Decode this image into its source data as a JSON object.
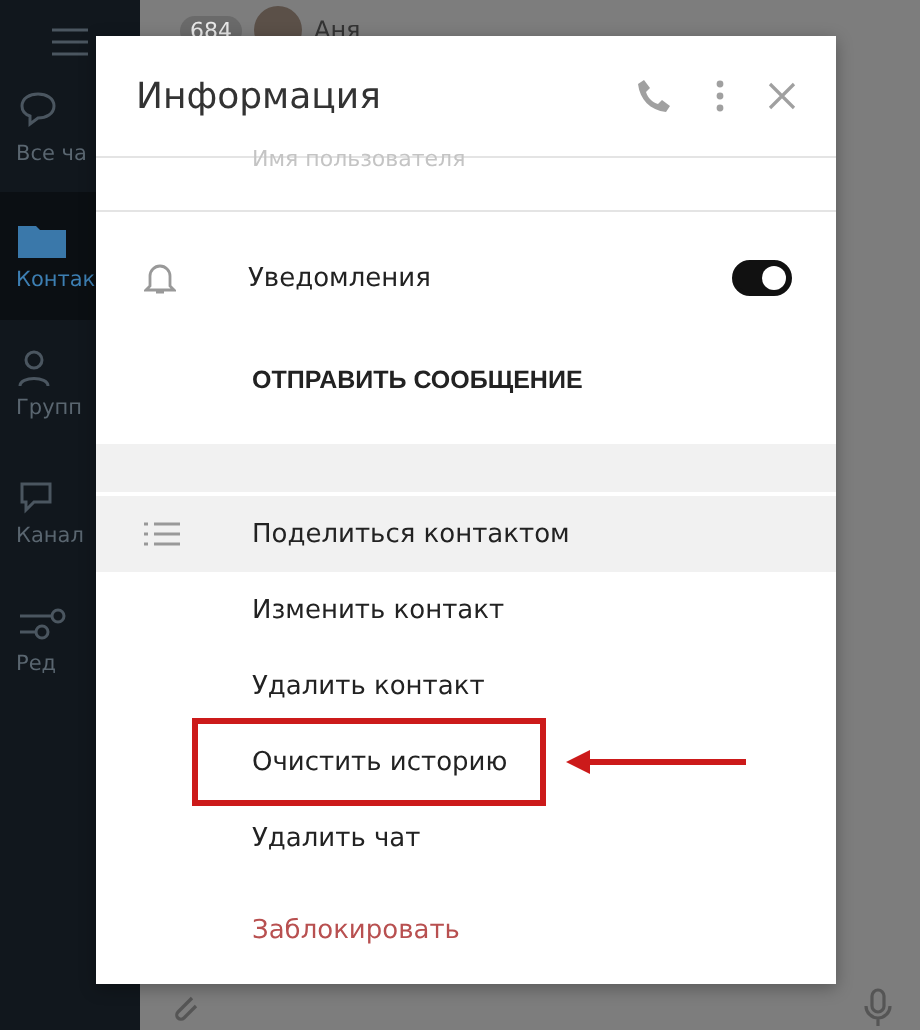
{
  "sidebar": {
    "items": [
      {
        "kind": "chats",
        "label": "Все ча",
        "selected": false
      },
      {
        "kind": "contacts",
        "label": "Контак",
        "selected": true
      },
      {
        "kind": "groups",
        "label": "Групп",
        "selected": false
      },
      {
        "kind": "channels",
        "label": "Канал",
        "selected": false
      },
      {
        "kind": "edit",
        "label": "Ред",
        "selected": false
      }
    ]
  },
  "chat_header": {
    "badge": "684",
    "name": "Аня"
  },
  "dialog": {
    "title": "Информация",
    "username_label": "Имя пользователя",
    "notifications": {
      "label": "Уведомления",
      "on": true
    },
    "send_message": "ОТПРАВИТЬ СООБЩЕНИЕ",
    "actions": [
      {
        "label": "Поделиться контактом",
        "kind": "normal",
        "selected": true,
        "annotated": false
      },
      {
        "label": "Изменить контакт",
        "kind": "normal",
        "selected": false,
        "annotated": false
      },
      {
        "label": "Удалить контакт",
        "kind": "normal",
        "selected": false,
        "annotated": false
      },
      {
        "label": "Очистить историю",
        "kind": "normal",
        "selected": false,
        "annotated": true
      },
      {
        "label": "Удалить чат",
        "kind": "normal",
        "selected": false,
        "annotated": false
      },
      {
        "label": "Заблокировать",
        "kind": "danger",
        "selected": false,
        "annotated": false
      }
    ]
  }
}
